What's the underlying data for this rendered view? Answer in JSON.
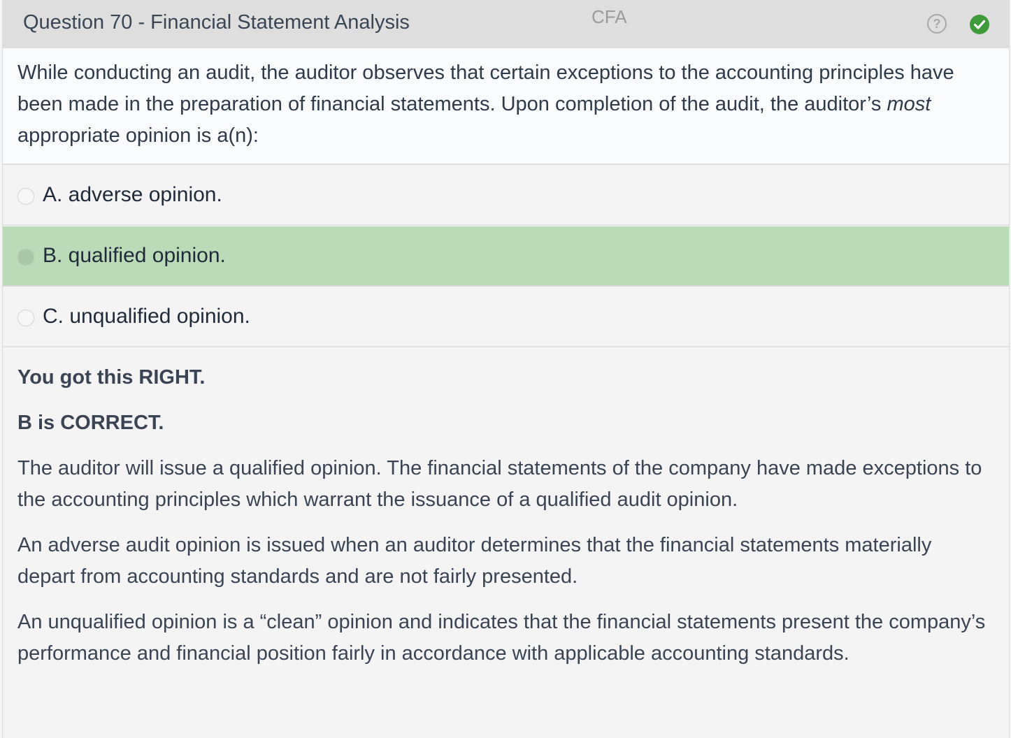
{
  "header": {
    "question_title": "Question 70 - Financial Statement Analysis",
    "subject": "CFA"
  },
  "question": {
    "stem_part1": "While conducting an audit, the auditor observes that certain exceptions to the accounting principles have been made in the preparation of financial statements.  Upon completion of the audit, the auditor’s ",
    "stem_emphasis": "most",
    "stem_part2": " appropriate opinion is a(n):"
  },
  "options": [
    {
      "label": "A. adverse opinion.",
      "selected": false
    },
    {
      "label": "B. qualified opinion.",
      "selected": true
    },
    {
      "label": "C. unqualified opinion.",
      "selected": false
    }
  ],
  "explanation": {
    "result": "You got this RIGHT.",
    "correct": "B is CORRECT.",
    "paragraphs": [
      "The auditor will issue a qualified opinion.  The financial statements of the company have made exceptions to the accounting principles which warrant the issuance of a qualified audit opinion.",
      "An adverse audit opinion is issued when an auditor determines that the financial statements materially depart from accounting standards and are not fairly presented.",
      "An unqualified opinion is a “clean” opinion and indicates that the financial statements present the company’s performance and financial position fairly in accordance with applicable accounting standards."
    ]
  },
  "icons": {
    "help": "question-circle-icon",
    "status": "check-circle-icon"
  },
  "colors": {
    "selected_correct_bg": "#b9dbb6",
    "check_green": "#3f9a3c",
    "header_bg": "#dedede"
  }
}
